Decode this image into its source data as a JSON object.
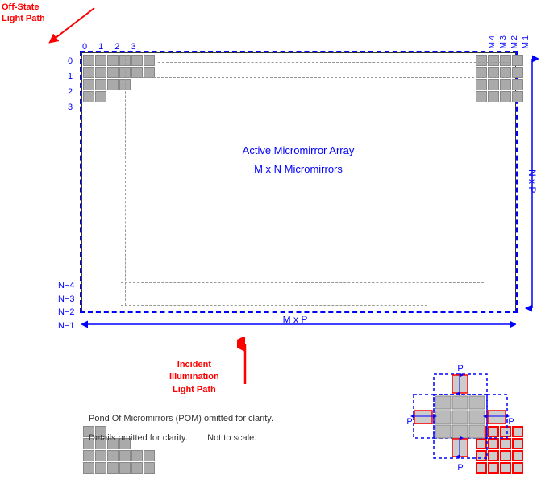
{
  "labels": {
    "off_state_line1": "Off-State",
    "off_state_line2": "Light Path",
    "col_nums_top": [
      "0",
      "1",
      "2",
      "3"
    ],
    "col_nums_top_right": [
      "4",
      "3",
      "2",
      "1"
    ],
    "col_nums_top_right_m": "M",
    "row_nums_left": [
      "0",
      "1",
      "2",
      "3"
    ],
    "row_nums_bottom": [
      "N−4",
      "N−3",
      "N−2",
      "N−1"
    ],
    "active_micromirror_array": "Active Micromirror Array",
    "m_x_n": "M x N  Micromirrors",
    "n_x_p": "N x P",
    "m_x_p": "M x P",
    "incident_line1": "Incident",
    "incident_line2": "Illumination",
    "incident_line3": "Light Path",
    "note1": "Pond Of Micromirrors (POM) omitted for clarity.",
    "note2": "Details omitted for clarity.",
    "note3": "Not to scale.",
    "p_label": "P"
  },
  "colors": {
    "blue": "#0000cc",
    "red": "#cc0000",
    "gray": "#aaaaaa",
    "darkgray": "#888888"
  }
}
